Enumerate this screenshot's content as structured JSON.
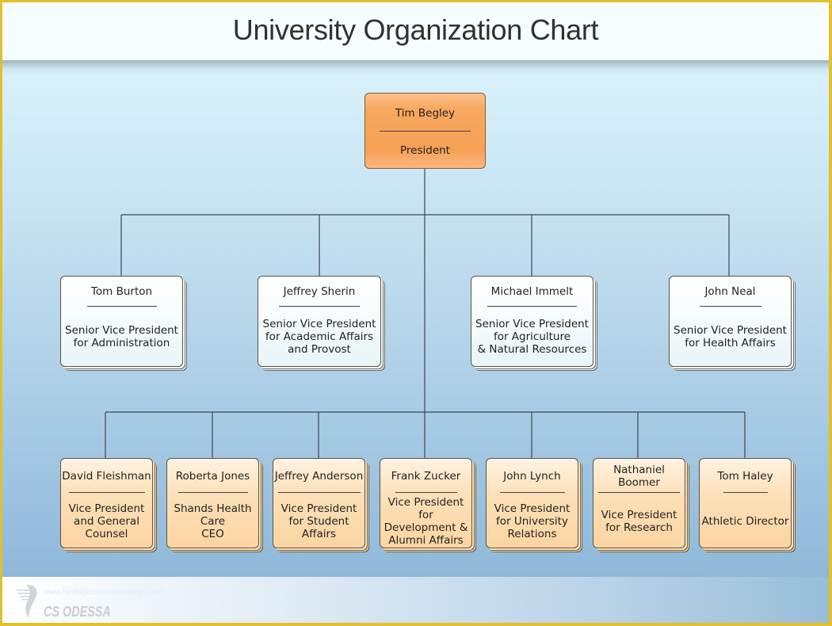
{
  "title": "University Organization Chart",
  "president": {
    "name": "Tim Begley",
    "title": "President"
  },
  "senior_vps": [
    {
      "name": "Tom Burton",
      "title": "Senior Vice President\nfor Administration"
    },
    {
      "name": "Jeffrey Sherin",
      "title": "Senior Vice President\nfor Academic Affairs\nand Provost"
    },
    {
      "name": "Michael Immelt",
      "title": "Senior Vice President\nfor Agriculture\n& Natural Resources"
    },
    {
      "name": "John Neal",
      "title": "Senior Vice President\nfor Health Affairs"
    }
  ],
  "vps": [
    {
      "name": "David Fleishman",
      "title": "Vice President\nand General\nCounsel"
    },
    {
      "name": "Roberta Jones",
      "title": "Shands Health\nCare\nCEO"
    },
    {
      "name": "Jeffrey Anderson",
      "title": "Vice President\nfor Student\nAffairs"
    },
    {
      "name": "Frank Zucker",
      "title": "Vice President\nfor\nDevelopment &\nAlumni Affairs"
    },
    {
      "name": "John Lynch",
      "title": "Vice President\nfor University\nRelations"
    },
    {
      "name": "Nathaniel\nBoomer",
      "title": "Vice President\nfor Research"
    },
    {
      "name": "Tom Haley",
      "title": "Athletic Director"
    }
  ],
  "footer": {
    "logo_text": "CS ODESSA",
    "watermark": "www.heritagechristiancollege.com"
  },
  "colors": {
    "frame": "#e0c02e",
    "president_fill": "#f6a055",
    "vp_fill": "#fbd5a2",
    "svp_fill": "#f7fcfd",
    "line": "#3c4650"
  }
}
